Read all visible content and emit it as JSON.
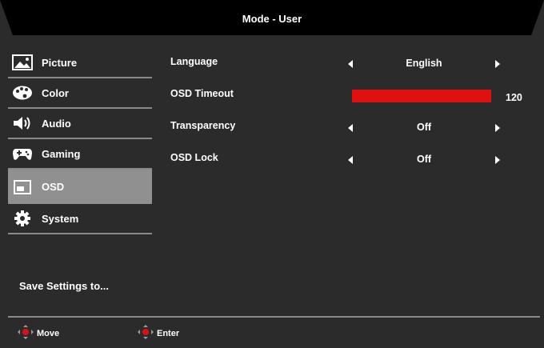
{
  "header": {
    "title": "Mode - User"
  },
  "sidebar": {
    "items": [
      {
        "label": "Picture",
        "icon": "picture-icon",
        "selected": false
      },
      {
        "label": "Color",
        "icon": "palette-icon",
        "selected": false
      },
      {
        "label": "Audio",
        "icon": "speaker-icon",
        "selected": false
      },
      {
        "label": "Gaming",
        "icon": "gamepad-icon",
        "selected": false
      },
      {
        "label": "OSD",
        "icon": "osd-window-icon",
        "selected": true
      },
      {
        "label": "System",
        "icon": "gear-icon",
        "selected": false
      }
    ],
    "save_label": "Save Settings to..."
  },
  "settings": {
    "language": {
      "label": "Language",
      "value": "English"
    },
    "osd_timeout": {
      "label": "OSD Timeout",
      "value": "120",
      "level": 1.0
    },
    "transparency": {
      "label": "Transparency",
      "value": "Off"
    },
    "osd_lock": {
      "label": "OSD Lock",
      "value": "Off"
    }
  },
  "footer": {
    "move_label": "Move",
    "enter_label": "Enter"
  },
  "colors": {
    "accent": "#e01010",
    "background": "#2b2b2b",
    "selected": "#909090"
  }
}
